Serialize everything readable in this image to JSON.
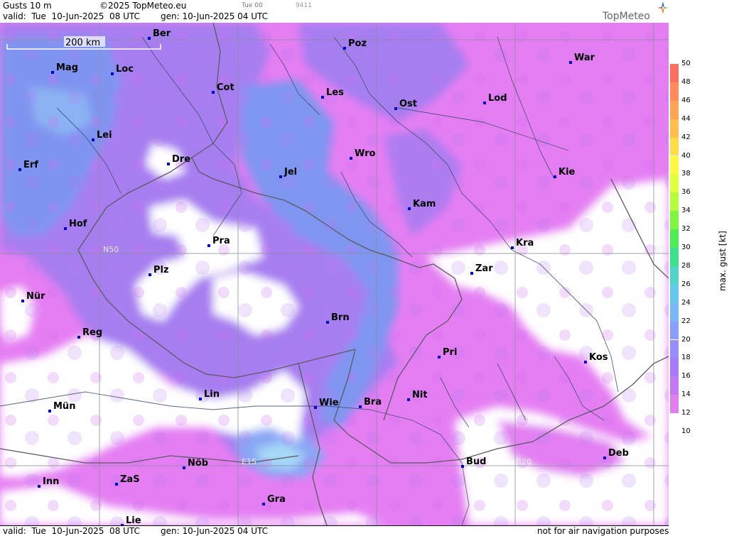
{
  "header": {
    "product": "Gusts 10 m",
    "copyright": "©2025 TopMeteo.eu",
    "valid": "valid:  Tue  10-Jun-2025  08 UTC",
    "gen": "gen: 10-Jun-2025 04 UTC",
    "run": "Tue 00",
    "code": "9411",
    "brand": "TopMeteo"
  },
  "footer": {
    "valid": "valid:  Tue  10-Jun-2025  08 UTC",
    "gen": "gen: 10-Jun-2025 04 UTC",
    "disclaimer": "not for air navigation purposes"
  },
  "scale_bar": {
    "label": "200 km"
  },
  "grid_labels": {
    "lat": "N50",
    "lat_right": "N5",
    "lon1": "E15",
    "lon2": "E20"
  },
  "cities": [
    {
      "name": "Ber"
    },
    {
      "name": "Poz"
    },
    {
      "name": "War"
    },
    {
      "name": "Mag"
    },
    {
      "name": "Loc"
    },
    {
      "name": "Cot"
    },
    {
      "name": "Les"
    },
    {
      "name": "Lod"
    },
    {
      "name": "Ost"
    },
    {
      "name": "Lei"
    },
    {
      "name": "Wro"
    },
    {
      "name": "Dre"
    },
    {
      "name": "Erf"
    },
    {
      "name": "Jel"
    },
    {
      "name": "Kie"
    },
    {
      "name": "Kam"
    },
    {
      "name": "Hof"
    },
    {
      "name": "Pra"
    },
    {
      "name": "Kra"
    },
    {
      "name": "Zar"
    },
    {
      "name": "Plz"
    },
    {
      "name": "Nür"
    },
    {
      "name": "Brn"
    },
    {
      "name": "Reg"
    },
    {
      "name": "Pri"
    },
    {
      "name": "Kos"
    },
    {
      "name": "Lin"
    },
    {
      "name": "Nit"
    },
    {
      "name": "Bra"
    },
    {
      "name": "Wie"
    },
    {
      "name": "Mün"
    },
    {
      "name": "Deb"
    },
    {
      "name": "Nöb"
    },
    {
      "name": "Bud"
    },
    {
      "name": "Inn"
    },
    {
      "name": "ZaS"
    },
    {
      "name": "Gra"
    },
    {
      "name": "Lie"
    }
  ],
  "colorbar": {
    "title": "max. gust [kt]",
    "ticks": [
      "50",
      "48",
      "46",
      "44",
      "42",
      "40",
      "38",
      "36",
      "34",
      "32",
      "30",
      "28",
      "26",
      "24",
      "22",
      "20",
      "18",
      "16",
      "14",
      "12",
      "10"
    ],
    "colors": [
      "#ff6f60",
      "#ff8a5a",
      "#ffa555",
      "#ffc04f",
      "#ffdc48",
      "#fff840",
      "#e0ff3c",
      "#b5fb3e",
      "#7df542",
      "#50ec56",
      "#3fe08c",
      "#52d5c8",
      "#66c8ef",
      "#78b8fa",
      "#8a9ffb",
      "#9a8cfb",
      "#a87cf9",
      "#c478f3",
      "#e27ef0",
      "#ffffff",
      "#ffffff"
    ]
  },
  "palette": {
    "white": "#ffffff",
    "magenta": "#e77ef3",
    "purple": "#a57ef0",
    "blue": "#7f94f0",
    "light_blue": "#8fb8f5",
    "cyan": "#9fe0f5"
  }
}
